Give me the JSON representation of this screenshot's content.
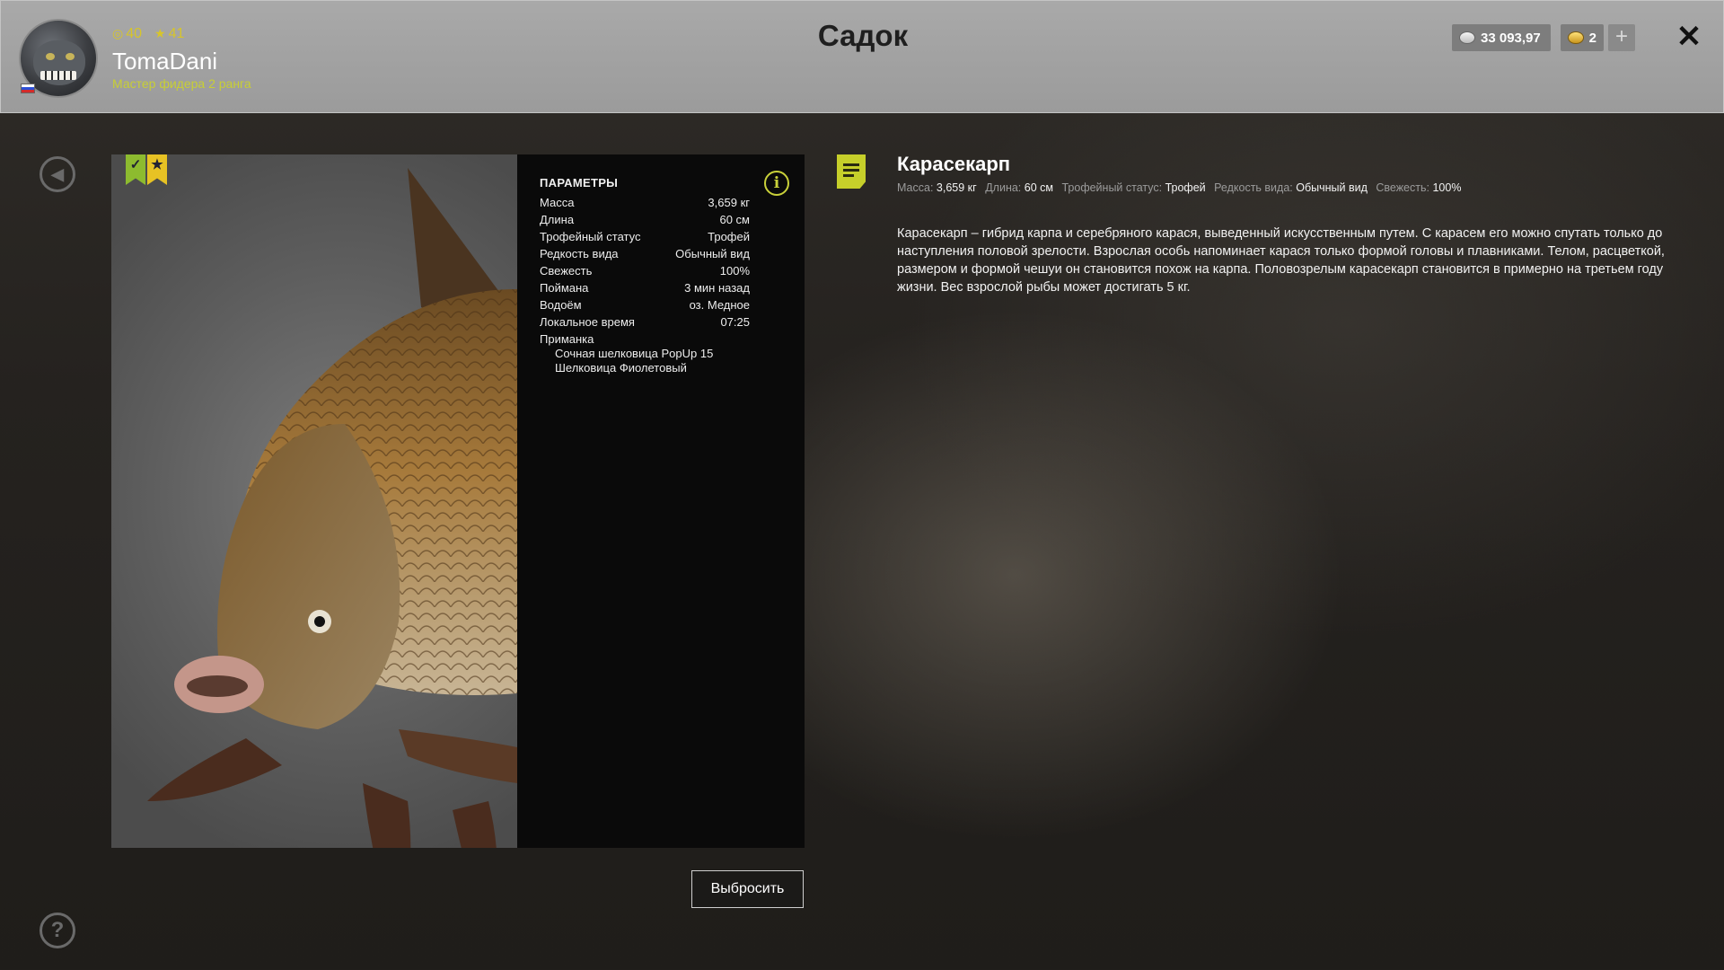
{
  "header": {
    "title": "Садок",
    "player": {
      "level": "40",
      "stars": "41",
      "username": "TomaDani",
      "rank": "Мастер фидера 2 ранга"
    },
    "silver": "33 093,97",
    "gold": "2",
    "plus_label": "+",
    "close_label": "✕"
  },
  "params": {
    "title": "ПАРАМЕТРЫ",
    "rows": [
      {
        "label": "Масса",
        "value": "3,659 кг"
      },
      {
        "label": "Длина",
        "value": "60 см"
      },
      {
        "label": "Трофейный статус",
        "value": "Трофей"
      },
      {
        "label": "Редкость вида",
        "value": "Обычный вид"
      },
      {
        "label": "Свежесть",
        "value": "100%"
      },
      {
        "label": "Поймана",
        "value": "3 мин назад"
      },
      {
        "label": "Водоём",
        "value": "оз. Медное"
      },
      {
        "label": "Локальное время",
        "value": "07:25"
      }
    ],
    "bait_label": "Приманка",
    "bait_items": [
      "Сочная шелковица PopUp 15",
      "Шелковица Фиолетовый"
    ]
  },
  "discard_label": "Выбросить",
  "fish": {
    "name": "Карасекарп",
    "meta": [
      {
        "label": "Масса:",
        "value": "3,659 кг"
      },
      {
        "label": "Длина:",
        "value": "60 см"
      },
      {
        "label": "Трофейный статус:",
        "value": "Трофей"
      },
      {
        "label": "Редкость вида:",
        "value": "Обычный вид"
      },
      {
        "label": "Свежесть:",
        "value": "100%"
      }
    ],
    "description": "Карасекарп – гибрид карпа и серебряного карася, выведенный искусственным путем. С карасем его можно спутать только до наступления половой зрелости. Взрослая особь напоминает карася только формой головы и плавниками. Телом, расцветкой, размером и формой чешуи он становится похож на карпа. Половозрелым карасекарп становится в примерно на третьем году жизни. Вес взрослой рыбы может достигать 5 кг."
  },
  "colors": {
    "accent_yellow_green": "#c6cf2a",
    "badge_green": "#8dbb2f",
    "badge_yellow": "#e7c224",
    "header_bg": "#a3a3a3"
  },
  "icons": [
    "avatar",
    "russia-flag",
    "level-icon",
    "star-icon",
    "silver-coin-icon",
    "gold-coin-icon",
    "plus-icon",
    "close-icon",
    "back-icon",
    "help-icon",
    "trophy-check-badge-icon",
    "star-badge-icon",
    "info-icon",
    "note-icon"
  ]
}
